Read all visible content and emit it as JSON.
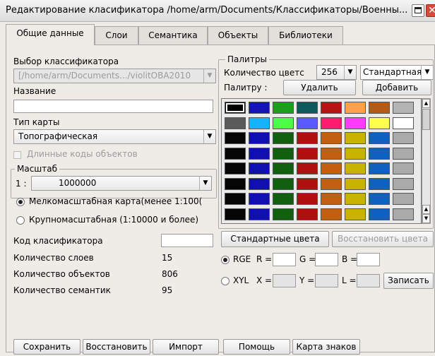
{
  "window": {
    "title": "Редактирование класификатора /home/arm/Documents/Классификаторы/Военны..."
  },
  "tabs": [
    {
      "label": "Общие данные"
    },
    {
      "label": "Слои"
    },
    {
      "label": "Семантика"
    },
    {
      "label": "Объекты"
    },
    {
      "label": "Библиотеки"
    }
  ],
  "left": {
    "classifier_select_label": "Выбор классификатора",
    "classifier_path": "[/home/arm/Documents.../violitOBA2010",
    "name_label": "Название",
    "name_value": "",
    "map_type_label": "Тип карты",
    "map_type_value": "Топографическая",
    "long_codes_label": "Длинные коды объектов",
    "scale_group_label": "Масштаб",
    "scale_prefix": "1 :",
    "scale_value": "1000000",
    "radio_small_label": "Мелкомасштабная карта(менее 1:100(",
    "radio_large_label": "Крупномасштабная (1:10000 и более)",
    "code_label": "Код класификатора",
    "code_value": "",
    "stats": [
      {
        "label": "Количество слоев",
        "value": "15"
      },
      {
        "label": "Количество объектов",
        "value": "806"
      },
      {
        "label": "Количество семантик",
        "value": "95"
      }
    ]
  },
  "palettes": {
    "group_label": "Палитры",
    "color_count_label": "Количество цветс",
    "color_count_value": "256",
    "palette_type_value": "Стандартная",
    "palette_label": "Палитру :",
    "delete_button": "Удалить",
    "add_button": "Добавить",
    "rows": [
      [
        "#000000",
        "#1414b4",
        "#1aa01a",
        "#0e5a5a",
        "#b41414",
        "#ffa04a",
        "#b45a14",
        "#b4b4b4"
      ],
      [
        "#5a5a5a",
        "#14b4ff",
        "#4aff4a",
        "#5a5aff",
        "#ff1a6e",
        "#ff3cff",
        "#ffff4a",
        "#ffffff"
      ],
      [
        "#050505",
        "#1010b0",
        "#106010",
        "#b01010",
        "#c06010",
        "#c8b400",
        "#1060c0",
        "#aaaaaa"
      ],
      [
        "#050505",
        "#1010b0",
        "#106010",
        "#b01010",
        "#c06010",
        "#c8b400",
        "#1060c0",
        "#aaaaaa"
      ],
      [
        "#050505",
        "#1010b0",
        "#106010",
        "#b01010",
        "#c06010",
        "#c8b400",
        "#1060c0",
        "#aaaaaa"
      ],
      [
        "#050505",
        "#1010b0",
        "#106010",
        "#b01010",
        "#c06010",
        "#c8b400",
        "#1060c0",
        "#aaaaaa"
      ],
      [
        "#050505",
        "#1010b0",
        "#106010",
        "#b01010",
        "#c06010",
        "#c8b400",
        "#1060c0",
        "#aaaaaa"
      ],
      [
        "#050505",
        "#1010b0",
        "#106010",
        "#b01010",
        "#c06010",
        "#c8b400",
        "#1060c0",
        "#aaaaaa"
      ]
    ],
    "standard_colors_button": "Стандартные цвета",
    "restore_colors_button": "Восстановить цвета",
    "rgb_label": "RGE",
    "r_label": "R =",
    "g_label": "G =",
    "b_label": "B =",
    "xyl_label": "XYL",
    "x_label": "X =",
    "y_label": "Y =",
    "l_label": "L =",
    "write_button": "Записать"
  },
  "bottom_buttons": [
    {
      "label": "Сохранить"
    },
    {
      "label": "Восстановить"
    },
    {
      "label": "Импорт"
    },
    {
      "label": "Помощь"
    },
    {
      "label": "Карта знаков"
    }
  ]
}
